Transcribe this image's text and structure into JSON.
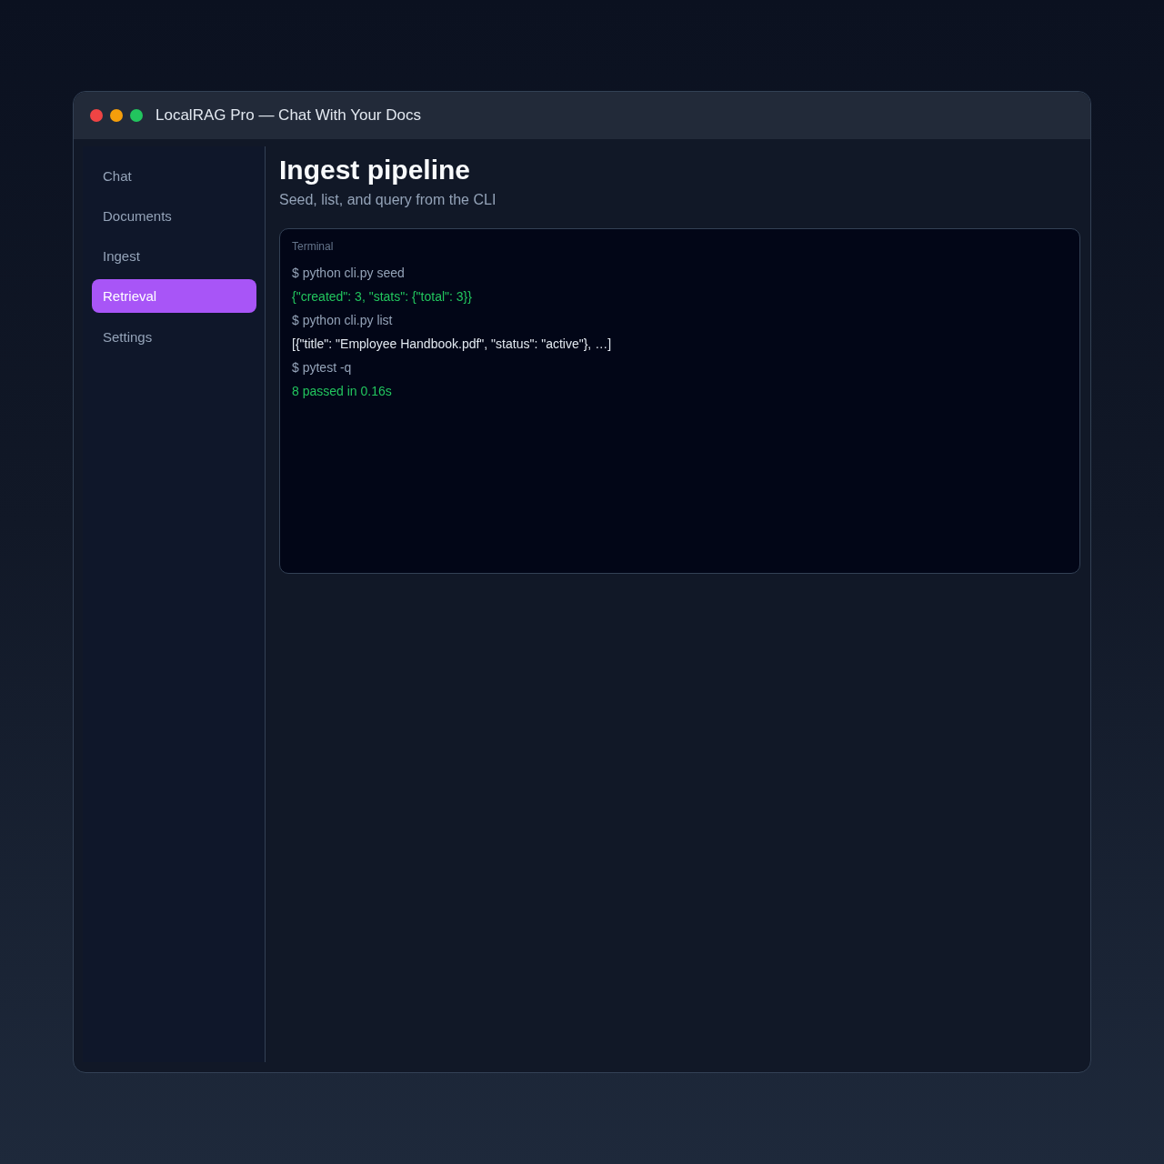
{
  "window": {
    "title": "LocalRAG Pro — Chat With Your Docs"
  },
  "sidebar": {
    "items": [
      {
        "label": "Chat",
        "selected": false
      },
      {
        "label": "Documents",
        "selected": false
      },
      {
        "label": "Ingest",
        "selected": false
      },
      {
        "label": "Retrieval",
        "selected": true
      },
      {
        "label": "Settings",
        "selected": false
      }
    ]
  },
  "page": {
    "title": "Ingest pipeline",
    "subtitle": "Seed, list, and query from the CLI"
  },
  "terminal": {
    "label": "Terminal",
    "lines": [
      {
        "kind": "command",
        "text": "$ python cli.py seed"
      },
      {
        "kind": "success",
        "text": "{\"created\": 3, \"stats\": {\"total\": 3}}"
      },
      {
        "kind": "command",
        "text": "$ python cli.py list"
      },
      {
        "kind": "output",
        "text": "[{\"title\": \"Employee Handbook.pdf\", \"status\": \"active\"}, …]"
      },
      {
        "kind": "command",
        "text": "$ pytest -q"
      },
      {
        "kind": "success",
        "text": "8 passed in 0.16s"
      }
    ]
  }
}
